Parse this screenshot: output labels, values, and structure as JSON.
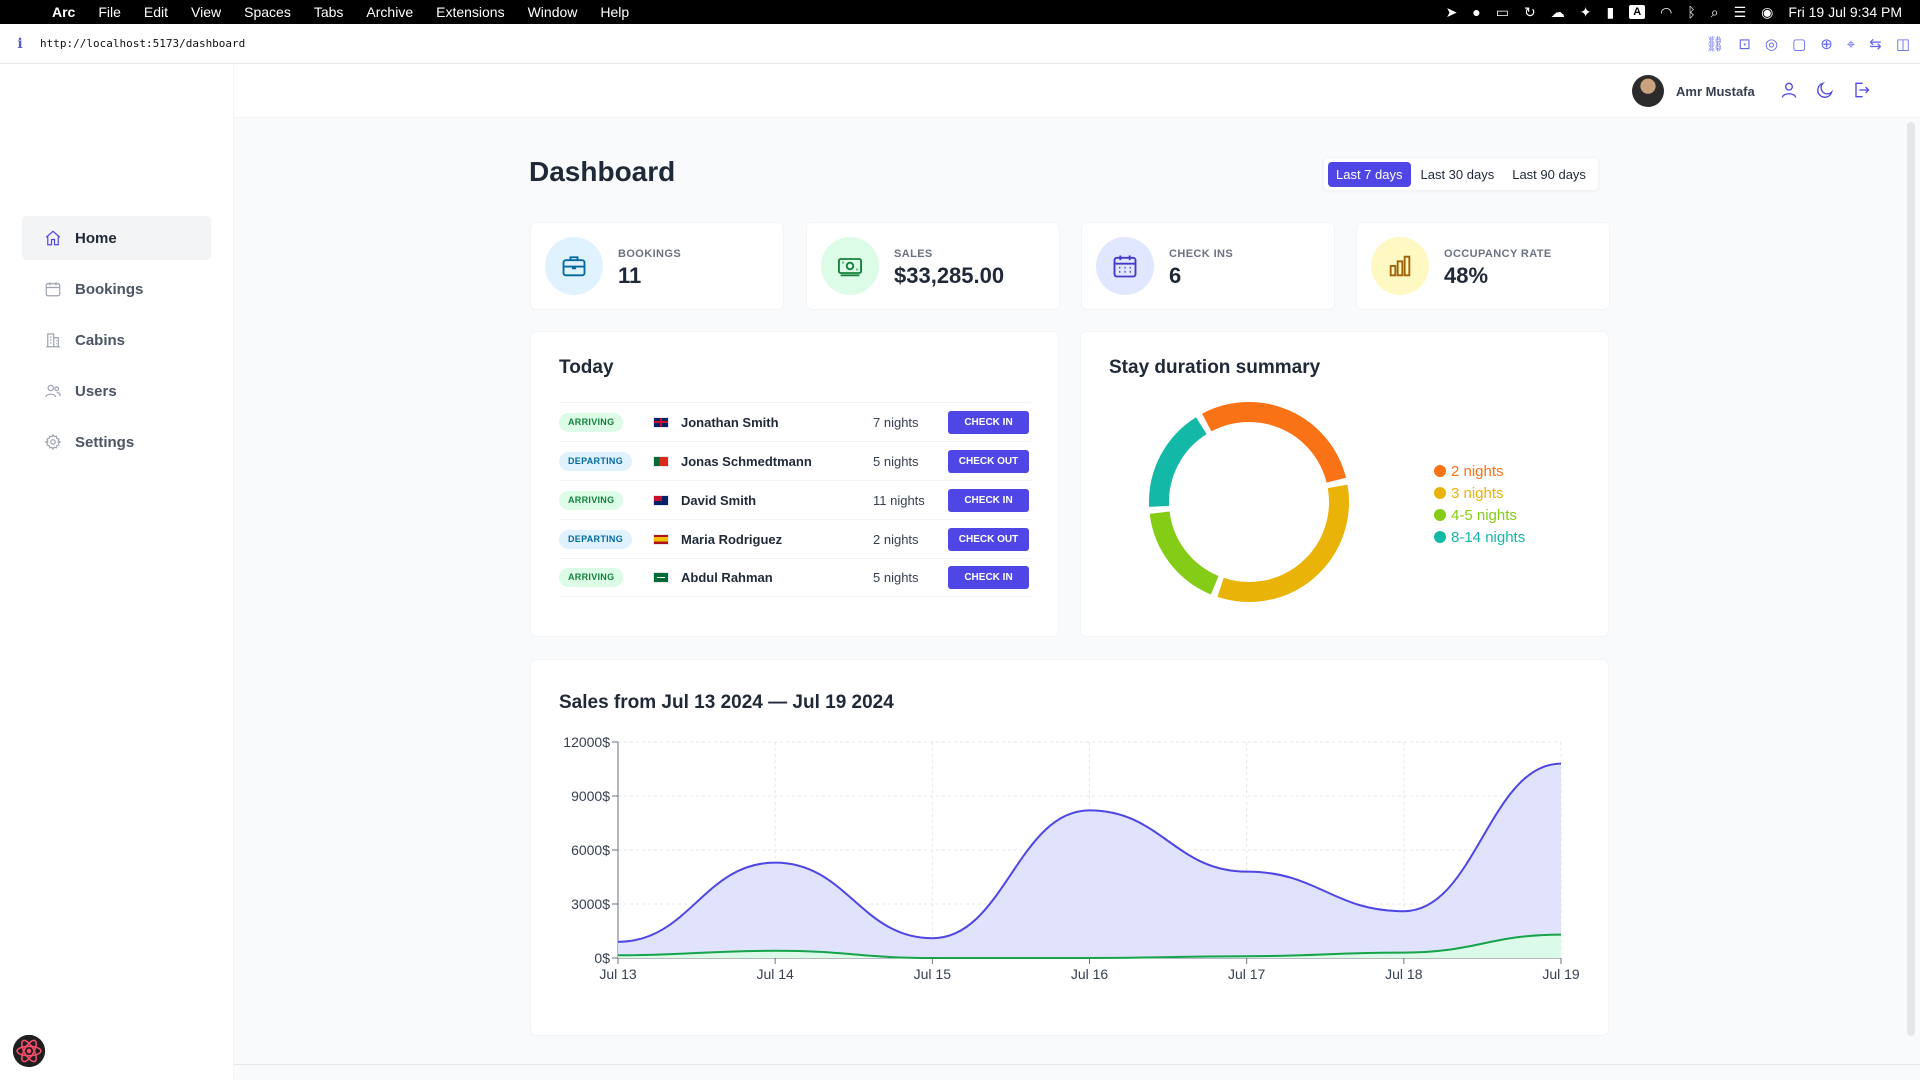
{
  "menubar": {
    "app": "Arc",
    "items": [
      "File",
      "Edit",
      "View",
      "Spaces",
      "Tabs",
      "Archive",
      "Extensions",
      "Window",
      "Help"
    ],
    "clock": "Fri 19 Jul  9:34 PM",
    "input_source": "A"
  },
  "browser": {
    "url": "http://localhost:5173/dashboard"
  },
  "sidebar": {
    "items": [
      {
        "label": "Home",
        "icon": "home-icon"
      },
      {
        "label": "Bookings",
        "icon": "calendar-icon"
      },
      {
        "label": "Cabins",
        "icon": "buildings-icon"
      },
      {
        "label": "Users",
        "icon": "users-icon"
      },
      {
        "label": "Settings",
        "icon": "gear-icon"
      }
    ]
  },
  "header": {
    "user_name": "Amr Mustafa"
  },
  "page": {
    "title": "Dashboard",
    "filters": [
      "Last 7 days",
      "Last 30 days",
      "Last 90 days"
    ]
  },
  "stats": [
    {
      "label": "BOOKINGS",
      "value": "11",
      "icon": "briefcase-icon",
      "bg": "#e0f2fe",
      "fg": "#0369a1"
    },
    {
      "label": "SALES",
      "value": "$33,285.00",
      "icon": "banknotes-icon",
      "bg": "#dcfce7",
      "fg": "#15803d"
    },
    {
      "label": "CHECK INS",
      "value": "6",
      "icon": "calendar-days-icon",
      "bg": "#e0e7ff",
      "fg": "#4338ca"
    },
    {
      "label": "OCCUPANCY RATE",
      "value": "48%",
      "icon": "bar-chart-icon",
      "bg": "#fef9c3",
      "fg": "#a16207"
    }
  ],
  "today": {
    "title": "Today",
    "rows": [
      {
        "status": "ARRIVING",
        "type": "arriving",
        "guest": "Jonathan Smith",
        "nights": "7 nights",
        "action": "CHECK IN",
        "flag": "gb"
      },
      {
        "status": "DEPARTING",
        "type": "departing",
        "guest": "Jonas Schmedtmann",
        "nights": "5 nights",
        "action": "CHECK OUT",
        "flag": "pt"
      },
      {
        "status": "ARRIVING",
        "type": "arriving",
        "guest": "David Smith",
        "nights": "11 nights",
        "action": "CHECK IN",
        "flag": "au"
      },
      {
        "status": "DEPARTING",
        "type": "departing",
        "guest": "Maria Rodriguez",
        "nights": "2 nights",
        "action": "CHECK OUT",
        "flag": "es"
      },
      {
        "status": "ARRIVING",
        "type": "arriving",
        "guest": "Abdul Rahman",
        "nights": "5 nights",
        "action": "CHECK IN",
        "flag": "sa"
      }
    ]
  },
  "stay": {
    "title": "Stay duration summary"
  },
  "sales": {
    "title": "Sales from Jul 13 2024 — Jul 19 2024"
  },
  "chart_data": [
    {
      "type": "pie",
      "title": "Stay duration summary",
      "categories": [
        "2 nights",
        "3 nights",
        "4-5 nights",
        "8-14 nights"
      ],
      "values": [
        30,
        34,
        18,
        18
      ],
      "colors": [
        "#f97316",
        "#eab308",
        "#84cc16",
        "#14b8a6"
      ],
      "legend": "right"
    },
    {
      "type": "area",
      "title": "Sales from Jul 13 2024 — Jul 19 2024",
      "categories": [
        "Jul 13",
        "Jul 14",
        "Jul 15",
        "Jul 16",
        "Jul 17",
        "Jul 18",
        "Jul 19"
      ],
      "series": [
        {
          "values": [
            900,
            5300,
            1100,
            8200,
            4800,
            2600,
            10800
          ],
          "color": "#4f46e5"
        },
        {
          "values": [
            150,
            400,
            0,
            0,
            100,
            300,
            1300
          ],
          "color": "#16a34a"
        }
      ],
      "ylim": [
        0,
        12000
      ],
      "yticks": [
        "0$",
        "3000$",
        "6000$",
        "9000$",
        "12000$"
      ],
      "grid": true
    }
  ]
}
